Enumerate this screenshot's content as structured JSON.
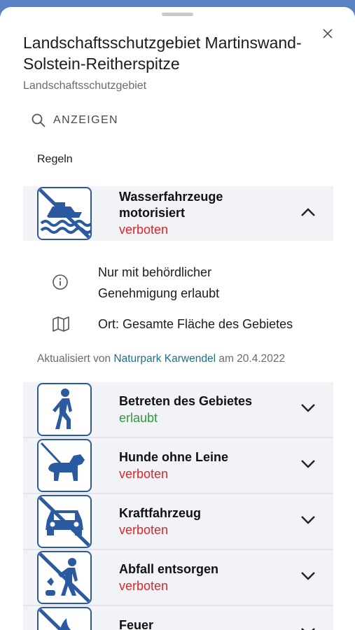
{
  "sheet": {
    "title": "Landschaftsschutzgebiet Martinswand-Solstein-Reitherspitze",
    "subtitle": "Landschaftsschutzgebiet",
    "show_label": "ANZEIGEN",
    "section_label": "Regeln"
  },
  "expanded_rule": {
    "name": "Wasserfahrzeuge motorisiert",
    "status": "verboten",
    "details": [
      {
        "icon": "info-icon",
        "text": "Nur mit behördlicher Genehmigung erlaubt"
      },
      {
        "icon": "map-icon",
        "text": "Ort: Gesamte Fläche des Gebietes"
      }
    ],
    "updated_prefix": "Aktualisiert von",
    "updated_by": "Naturpark Karwendel",
    "updated_suffix": "am 20.4.2022"
  },
  "rules": [
    {
      "name": "Betreten des Gebietes",
      "status": "erlaubt",
      "icon": "hiker-icon"
    },
    {
      "name": "Hunde ohne Leine",
      "status": "verboten",
      "icon": "dog-on-leash-icon"
    },
    {
      "name": "Kraftfahrzeug",
      "status": "verboten",
      "icon": "no-car-icon"
    },
    {
      "name": "Abfall entsorgen",
      "status": "verboten",
      "icon": "no-littering-icon"
    },
    {
      "name": "Feuer",
      "status": "",
      "icon": "no-fire-icon"
    }
  ],
  "colors": {
    "accent": "#2b5aa0",
    "forbidden": "#e0222a",
    "allowed": "#2e9a3a",
    "link": "#1f6f8b"
  }
}
